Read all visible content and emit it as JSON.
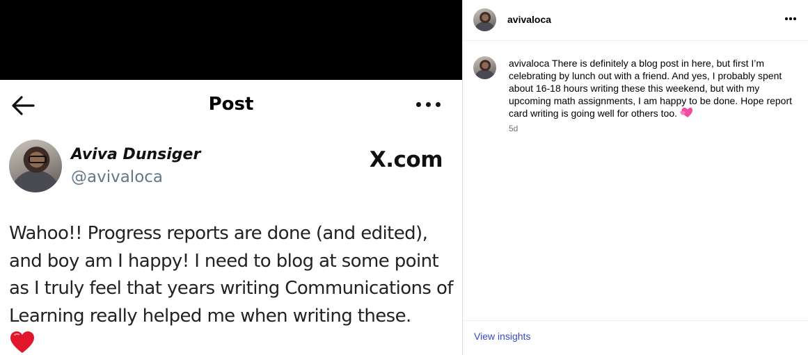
{
  "media": {
    "x_post": {
      "header_title": "Post",
      "author_name": "Aviva Dunsiger",
      "author_handle": "@avivaloca",
      "brand": "X.com",
      "body_text": "Wahoo!! Progress reports are done (and edited), and boy am I happy! I need to blog at some point as I truly feel that years writing Communications of Learning really helped me when writing these.",
      "emoji_icon": "red-heart-icon"
    }
  },
  "panel": {
    "header": {
      "username": "avivaloca",
      "more_icon": "more-options-icon"
    },
    "caption": {
      "username": "avivaloca",
      "text": "There is definitely a blog post in here, but first I’m celebrating by lunch out with a friend. And yes, I probably spent about 16-18 hours writing these this weekend, but with my upcoming math assignments, I am happy to be done. Hope report card writing is going well for others too.",
      "emoji_icon": "two-hearts-icon",
      "timestamp": "5d"
    },
    "footer": {
      "insights_label": "View insights"
    }
  },
  "colors": {
    "link_blue": "#3548c9",
    "muted_gray": "#737373",
    "handle_gray": "#657786",
    "heart_red": "#e0162b",
    "heart_pink": "#f24a9c"
  }
}
